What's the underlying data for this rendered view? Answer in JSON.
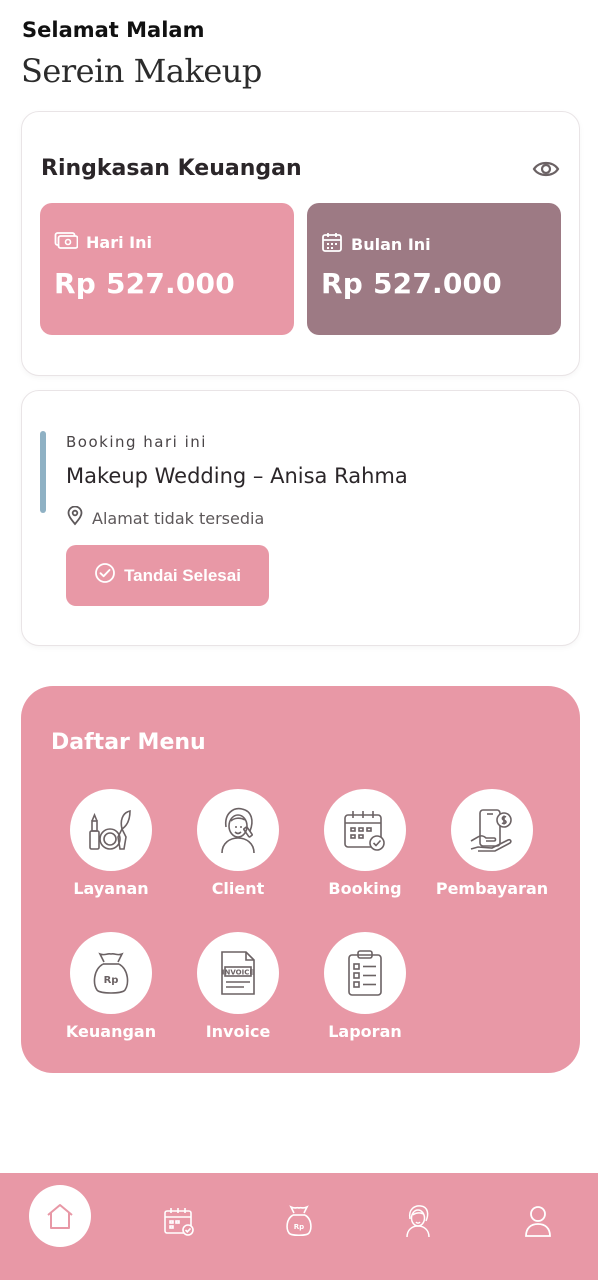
{
  "header": {
    "greeting": "Selamat Malam",
    "brand": "Serein Makeup"
  },
  "finance": {
    "title": "Ringkasan Keuangan",
    "toggle_icon": "eye-icon",
    "today": {
      "label": "Hari Ini",
      "value": "Rp 527.000",
      "icon": "cash-icon",
      "color": "#e898a6"
    },
    "month": {
      "label": "Bulan Ini",
      "value": "Rp 527.000",
      "icon": "calendar-icon",
      "color": "#9d7a84"
    }
  },
  "booking": {
    "label": "Booking hari ini",
    "title": "Makeup Wedding – Anisa Rahma",
    "address": "Alamat tidak tersedia",
    "action_label": "Tandai Selesai",
    "accent": "#8fb1c4"
  },
  "menu": {
    "title": "Daftar Menu",
    "items": [
      {
        "label": "Layanan",
        "icon": "cosmetics-icon"
      },
      {
        "label": "Client",
        "icon": "client-icon"
      },
      {
        "label": "Booking",
        "icon": "calendar-check-icon"
      },
      {
        "label": "Pembayaran",
        "icon": "payment-phone-icon"
      },
      {
        "label": "Keuangan",
        "icon": "money-bag-icon"
      },
      {
        "label": "Invoice",
        "icon": "invoice-icon"
      },
      {
        "label": "Laporan",
        "icon": "clipboard-report-icon"
      }
    ]
  },
  "nav": {
    "items": [
      "home-icon",
      "calendar-check-icon",
      "money-bag-icon",
      "client-icon",
      "user-icon"
    ],
    "active": "home-icon"
  },
  "colors": {
    "primary": "#e898a6",
    "secondary": "#9d7a84",
    "icon_stroke": "#6b6264"
  }
}
